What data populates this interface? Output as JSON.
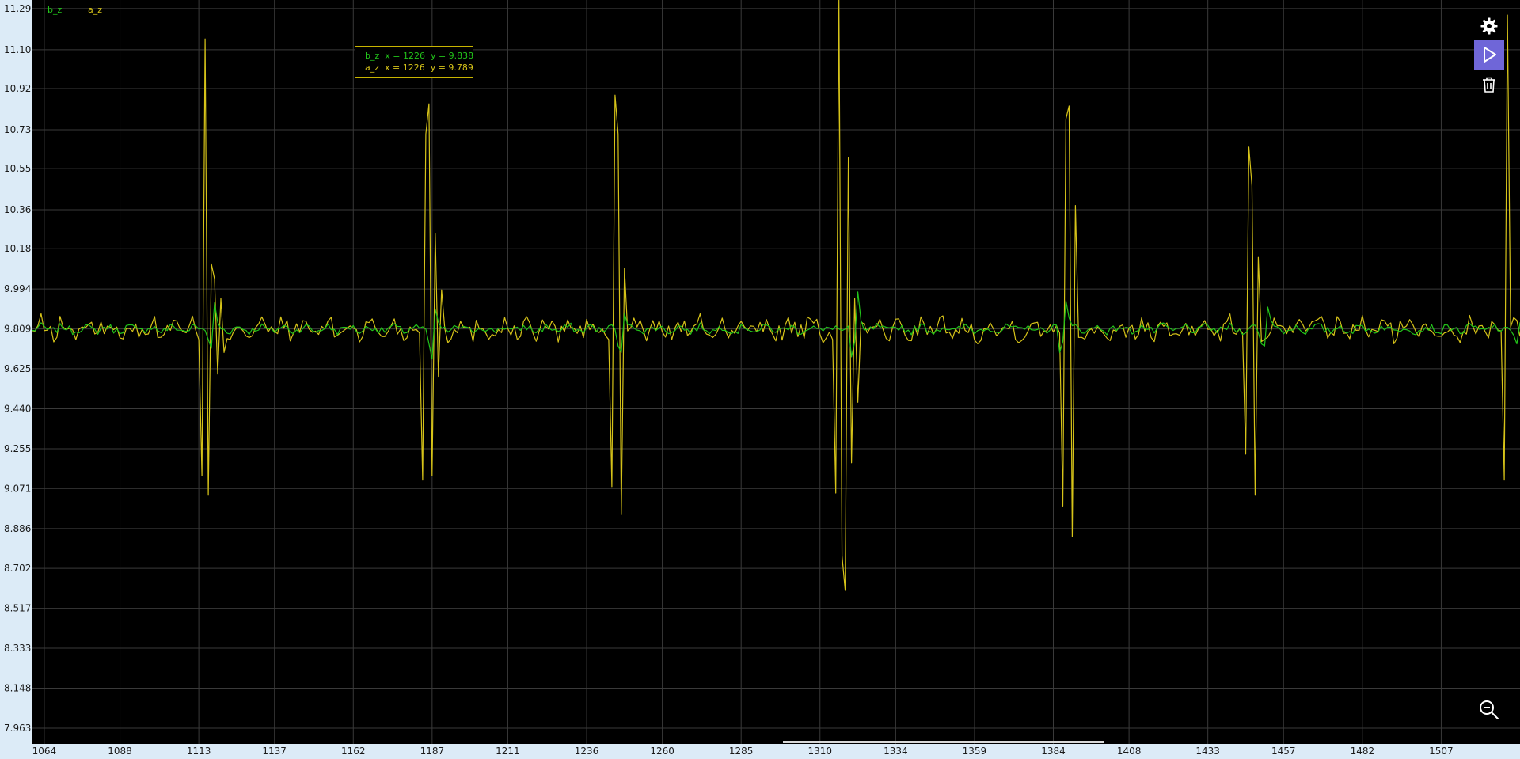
{
  "colors": {
    "b_z": "#22c41a",
    "a_z": "#d6c319",
    "grid": "#3a3a3a",
    "plot_bg": "#000000",
    "axis_bg": "#dcebf7",
    "play_button_bg": "#6f66d8"
  },
  "tooltip": {
    "line1": "b_z  x = 1226  y = 9.838",
    "line2": "a_z  x = 1226  y = 9.789"
  },
  "toolbar": {
    "settings_icon": "gear-icon",
    "play_icon": "play-icon",
    "delete_icon": "trash-icon",
    "zoom_icon": "zoom-out-icon"
  },
  "chart_data": {
    "type": "line",
    "xlim": [
      1060,
      1532
    ],
    "ylim": [
      7.89,
      11.33
    ],
    "x_ticks": [
      1064,
      1088,
      1113,
      1137,
      1162,
      1187,
      1211,
      1236,
      1260,
      1285,
      1310,
      1334,
      1359,
      1384,
      1408,
      1433,
      1457,
      1482,
      1507
    ],
    "y_ticks": [
      {
        "value": 11.29,
        "label": "11.29"
      },
      {
        "value": 11.1,
        "label": "11.10"
      },
      {
        "value": 10.92,
        "label": "10.92"
      },
      {
        "value": 10.73,
        "label": "10.73"
      },
      {
        "value": 10.55,
        "label": "10.55"
      },
      {
        "value": 10.36,
        "label": "10.36"
      },
      {
        "value": 10.18,
        "label": "10.18"
      },
      {
        "value": 9.994,
        "label": "9.994"
      },
      {
        "value": 9.809,
        "label": "9.809"
      },
      {
        "value": 9.625,
        "label": "9.625"
      },
      {
        "value": 9.44,
        "label": "9.440"
      },
      {
        "value": 9.255,
        "label": "9.255"
      },
      {
        "value": 9.071,
        "label": "9.071"
      },
      {
        "value": 8.886,
        "label": "8.886"
      },
      {
        "value": 8.702,
        "label": "8.702"
      },
      {
        "value": 8.517,
        "label": "8.517"
      },
      {
        "value": 8.333,
        "label": "8.333"
      },
      {
        "value": 8.148,
        "label": "8.148"
      },
      {
        "value": 7.963,
        "label": "7.963"
      }
    ],
    "grid": true,
    "legend_position": "top-left",
    "baseline": 9.809,
    "series": [
      {
        "name": "b_z",
        "sample_step": 1,
        "noise_amplitude": 0.018,
        "spikes": [
          {
            "x": 1116,
            "values": [
              9.76,
              9.72,
              9.93,
              9.84
            ]
          },
          {
            "x": 1186,
            "values": [
              9.74,
              9.67,
              9.9,
              9.84
            ]
          },
          {
            "x": 1246,
            "values": [
              9.73,
              9.7,
              9.88,
              9.83
            ]
          },
          {
            "x": 1320,
            "values": [
              9.68,
              9.75,
              9.98,
              9.85
            ]
          },
          {
            "x": 1386,
            "values": [
              9.7,
              9.75,
              9.94,
              9.86
            ]
          },
          {
            "x": 1450,
            "values": [
              9.74,
              9.73,
              9.91,
              9.85
            ]
          },
          {
            "x": 1530,
            "values": [
              9.78,
              9.74,
              9.84
            ]
          }
        ]
      },
      {
        "name": "a_z",
        "sample_step": 1,
        "noise_amplitude": 0.045,
        "spikes": [
          {
            "x": 1113,
            "values": [
              9.76,
              9.13,
              11.15,
              9.04,
              10.11,
              10.04,
              9.6,
              9.95,
              9.7
            ]
          },
          {
            "x": 1183,
            "values": [
              9.79,
              9.11,
              10.71,
              10.85,
              9.13,
              10.25,
              9.59,
              9.99
            ]
          },
          {
            "x": 1243,
            "values": [
              9.76,
              9.08,
              10.89,
              10.71,
              8.95,
              10.09,
              9.8
            ]
          },
          {
            "x": 1314,
            "values": [
              9.76,
              9.05,
              11.33,
              8.76,
              8.6,
              10.6,
              9.19,
              9.95,
              9.47
            ]
          },
          {
            "x": 1386,
            "values": [
              9.79,
              8.99,
              10.78,
              10.84,
              8.85,
              10.38,
              9.77
            ]
          },
          {
            "x": 1444,
            "values": [
              9.79,
              9.23,
              10.65,
              10.47,
              9.04,
              10.14,
              9.75
            ]
          },
          {
            "x": 1526,
            "values": [
              9.8,
              9.11,
              11.26
            ]
          }
        ]
      }
    ]
  }
}
